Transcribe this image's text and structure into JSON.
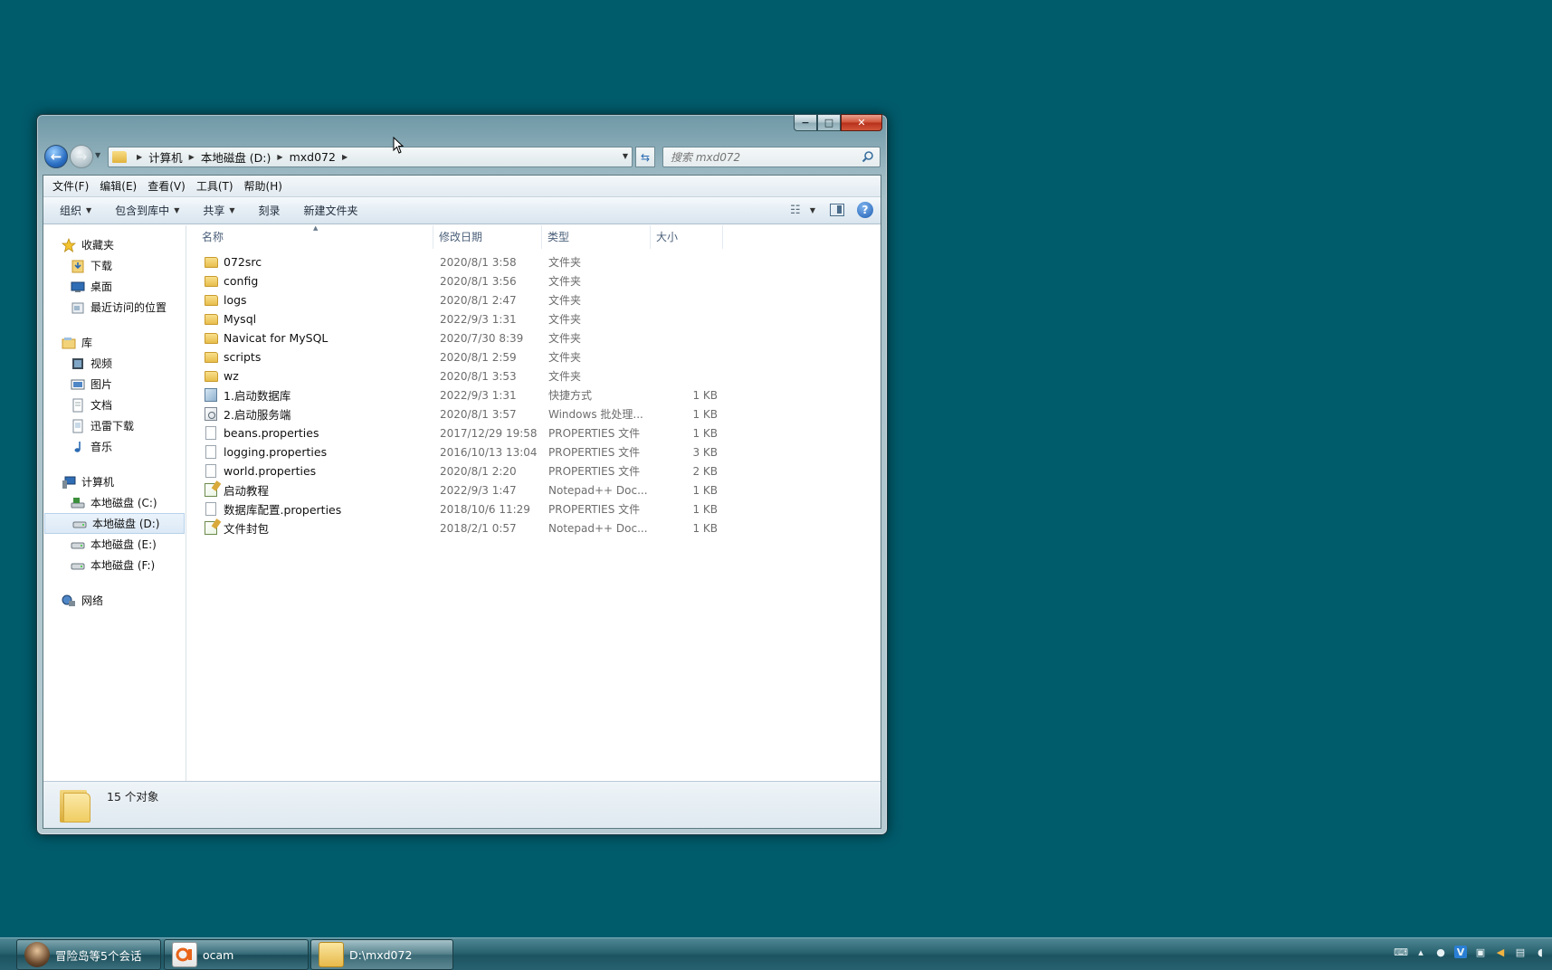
{
  "window": {
    "controls": {
      "minimize": "−",
      "maximize": "□",
      "close": "✕"
    }
  },
  "address": {
    "crumbs": [
      "计算机",
      "本地磁盘 (D:)",
      "mxd072"
    ]
  },
  "search": {
    "placeholder": "搜索 mxd072"
  },
  "menu": [
    "文件(F)",
    "编辑(E)",
    "查看(V)",
    "工具(T)",
    "帮助(H)"
  ],
  "toolbar": {
    "organize": "组织",
    "include_library": "包含到库中",
    "share": "共享",
    "burn": "刻录",
    "new_folder": "新建文件夹",
    "help": "?"
  },
  "nav": {
    "favorites": {
      "label": "收藏夹",
      "items": [
        "下载",
        "桌面",
        "最近访问的位置"
      ]
    },
    "libraries": {
      "label": "库",
      "items": [
        "视频",
        "图片",
        "文档",
        "迅雷下载",
        "音乐"
      ]
    },
    "computer": {
      "label": "计算机",
      "items": [
        "本地磁盘 (C:)",
        "本地磁盘 (D:)",
        "本地磁盘 (E:)",
        "本地磁盘 (F:)"
      ],
      "selected": "本地磁盘 (D:)"
    },
    "network": {
      "label": "网络"
    }
  },
  "columns": {
    "name": "名称",
    "date": "修改日期",
    "type": "类型",
    "size": "大小"
  },
  "files": [
    {
      "icon": "folder-icon",
      "name": "072src",
      "date": "2020/8/1 3:58",
      "type": "文件夹",
      "size": ""
    },
    {
      "icon": "folder-icon",
      "name": "config",
      "date": "2020/8/1 3:56",
      "type": "文件夹",
      "size": ""
    },
    {
      "icon": "folder-icon",
      "name": "logs",
      "date": "2020/8/1 2:47",
      "type": "文件夹",
      "size": ""
    },
    {
      "icon": "folder-icon",
      "name": "Mysql",
      "date": "2022/9/3 1:31",
      "type": "文件夹",
      "size": ""
    },
    {
      "icon": "folder-icon",
      "name": "Navicat for MySQL",
      "date": "2020/7/30 8:39",
      "type": "文件夹",
      "size": ""
    },
    {
      "icon": "folder-icon",
      "name": "scripts",
      "date": "2020/8/1 2:59",
      "type": "文件夹",
      "size": ""
    },
    {
      "icon": "folder-icon",
      "name": "wz",
      "date": "2020/8/1 3:53",
      "type": "文件夹",
      "size": ""
    },
    {
      "icon": "shortcut-icon",
      "name": "1.启动数据库",
      "date": "2022/9/3 1:31",
      "type": "快捷方式",
      "size": "1 KB"
    },
    {
      "icon": "batch-file-icon",
      "name": "2.启动服务端",
      "date": "2020/8/1 3:57",
      "type": "Windows 批处理...",
      "size": "1 KB"
    },
    {
      "icon": "document-icon",
      "name": "beans.properties",
      "date": "2017/12/29 19:58",
      "type": "PROPERTIES 文件",
      "size": "1 KB"
    },
    {
      "icon": "document-icon",
      "name": "logging.properties",
      "date": "2016/10/13 13:04",
      "type": "PROPERTIES 文件",
      "size": "3 KB"
    },
    {
      "icon": "document-icon",
      "name": "world.properties",
      "date": "2020/8/1 2:20",
      "type": "PROPERTIES 文件",
      "size": "2 KB"
    },
    {
      "icon": "notepad-icon",
      "name": "启动教程",
      "date": "2022/9/3 1:47",
      "type": "Notepad++ Doc...",
      "size": "1 KB"
    },
    {
      "icon": "document-icon",
      "name": "数据库配置.properties",
      "date": "2018/10/6 11:29",
      "type": "PROPERTIES 文件",
      "size": "1 KB"
    },
    {
      "icon": "notepad-icon",
      "name": "文件封包",
      "date": "2018/2/1 0:57",
      "type": "Notepad++ Doc...",
      "size": "1 KB"
    }
  ],
  "status": {
    "count": "15 个对象"
  },
  "taskbar": {
    "buttons": [
      "冒险岛等5个会话",
      "ocam",
      "D:\\mxd072"
    ],
    "active": "D:\\mxd072"
  }
}
